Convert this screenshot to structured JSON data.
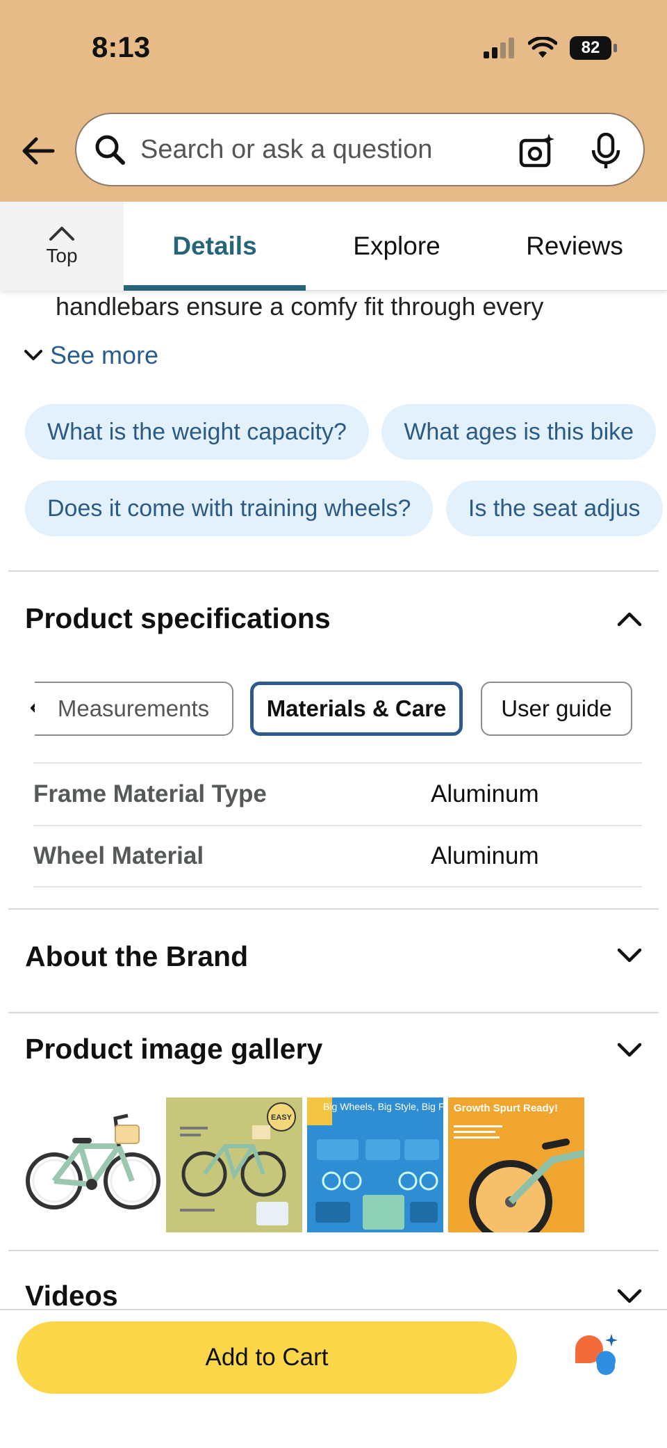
{
  "status_bar": {
    "time": "8:13",
    "battery": "82"
  },
  "search": {
    "placeholder": "Search or ask a question"
  },
  "tabs": {
    "top_label": "Top",
    "items": [
      {
        "label": "Details",
        "active": true
      },
      {
        "label": "Explore",
        "active": false
      },
      {
        "label": "Reviews",
        "active": false
      }
    ]
  },
  "description": {
    "text": "handlebars ensure a comfy fit through every",
    "see_more": "See more"
  },
  "questions": {
    "row1": [
      "What is the weight capacity?",
      "What ages is this bike"
    ],
    "row2": [
      "Does it come with training wheels?",
      "Is the seat adjus"
    ]
  },
  "product_specifications": {
    "title": "Product specifications",
    "tabs": [
      {
        "label": "Measurements",
        "active": false
      },
      {
        "label": "Materials & Care",
        "active": true
      },
      {
        "label": "User guide",
        "active": false
      }
    ],
    "rows": [
      {
        "key": "Frame Material Type",
        "value": "Aluminum"
      },
      {
        "key": "Wheel Material",
        "value": "Aluminum"
      }
    ]
  },
  "about_brand": {
    "title": "About the Brand"
  },
  "gallery": {
    "title": "Product image gallery",
    "images": [
      {
        "caption": ""
      },
      {
        "caption": "EASY"
      },
      {
        "caption": "Big Wheels, Big Style, Big Fun!"
      },
      {
        "caption": "Growth Spurt Ready!"
      }
    ]
  },
  "videos": {
    "title": "Videos"
  },
  "bottom_bar": {
    "add_to_cart": "Add to Cart"
  },
  "colors": {
    "header_bg": "#e6bb88",
    "active_tab": "#266577",
    "link": "#2a5d8f",
    "chip_bg": "#e3f1fd",
    "cart_button": "#fbd649"
  }
}
